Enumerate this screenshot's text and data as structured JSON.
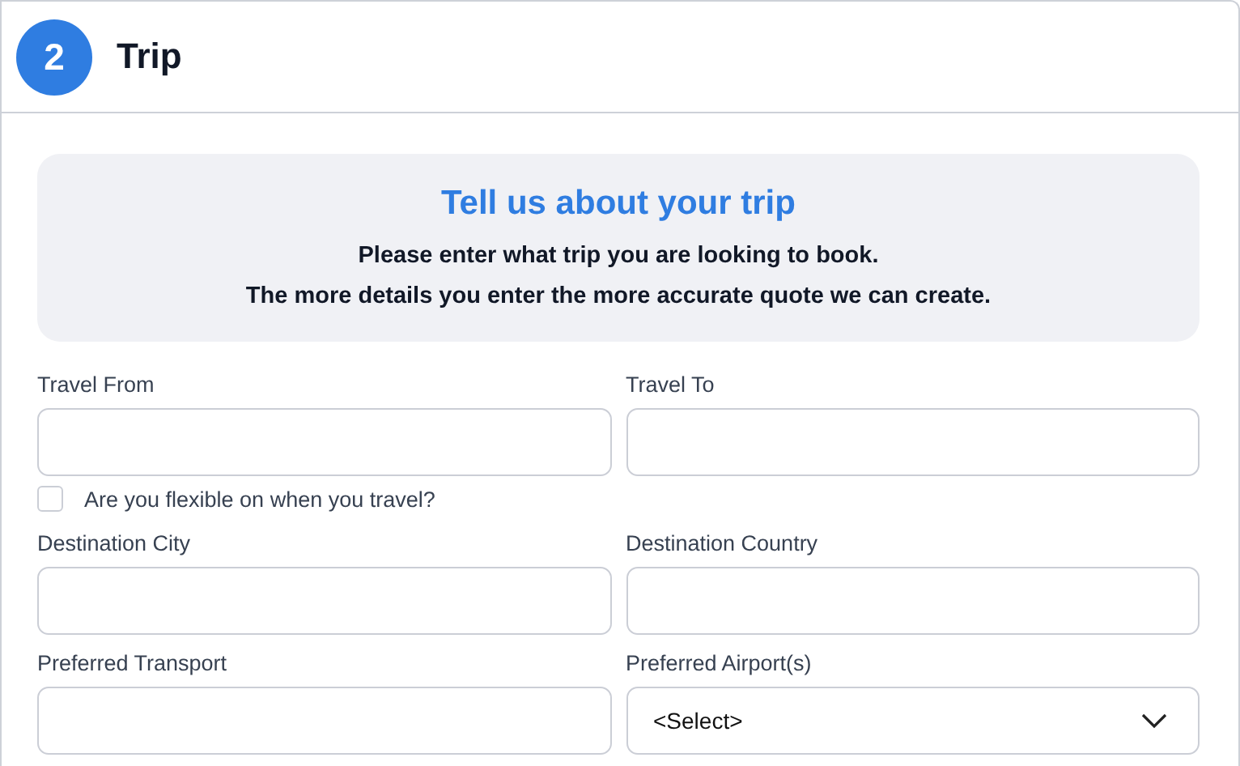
{
  "section": {
    "step": "2",
    "title": "Trip"
  },
  "banner": {
    "title": "Tell us about your trip",
    "lines": [
      "Please enter what trip you are looking to book.",
      "The more details you enter the more accurate quote we can create."
    ]
  },
  "form_rows": [
    {
      "kind": "pair",
      "fields": [
        {
          "label": "Travel From",
          "kind": "text"
        },
        {
          "label": "Travel To",
          "kind": "text"
        }
      ]
    },
    {
      "kind": "checkbox",
      "label": "Are you flexible on when you travel?",
      "checked": false
    },
    {
      "kind": "pair",
      "fields": [
        {
          "label": "Destination City",
          "kind": "text"
        },
        {
          "label": "Destination Country",
          "kind": "text"
        }
      ]
    },
    {
      "kind": "pair",
      "fields": [
        {
          "label": "Preferred Transport",
          "kind": "text"
        },
        {
          "label": "Preferred Airport(s)",
          "kind": "select",
          "value": "<Select>"
        }
      ]
    }
  ]
}
